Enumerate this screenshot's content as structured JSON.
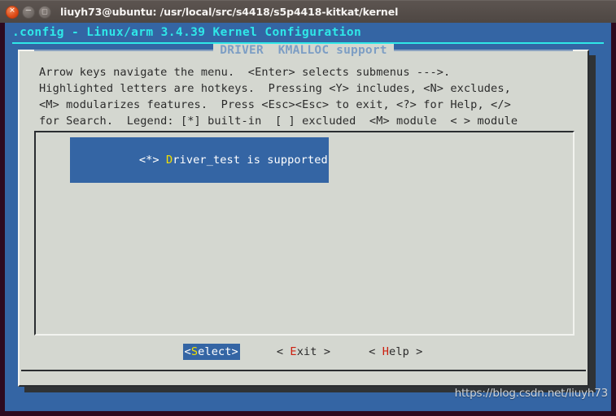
{
  "window": {
    "title": "liuyh73@ubuntu: /usr/local/src/s4418/s5p4418-kitkat/kernel",
    "controls": {
      "close_glyph": "✕",
      "minimize_glyph": "‒",
      "maximize_glyph": "□"
    }
  },
  "terminal": {
    "kconfig_title": ".config - Linux/arm 3.4.39 Kernel Configuration"
  },
  "dialog": {
    "menu_heading": "DRIVER  KMALLOC support",
    "help_text": "Arrow keys navigate the menu.  <Enter> selects submenus --->.\nHighlighted letters are hotkeys.  Pressing <Y> includes, <N> excludes,\n<M> modularizes features.  Press <Esc><Esc> to exit, <?> for Help, </>\nfor Search.  Legend: [*] built-in  [ ] excluded  <M> module  < > module",
    "items": [
      {
        "prefix": "<*> ",
        "hotkey": "D",
        "rest": "river_test is supported",
        "full_label": "<*> Driver_test is supported",
        "selected": true
      }
    ],
    "buttons": [
      {
        "open": "<",
        "pre": "",
        "hotkey": "S",
        "rest": "elect",
        "close": ">",
        "label": "<Select>",
        "active": true
      },
      {
        "open": "< ",
        "pre": "",
        "hotkey": "E",
        "rest": "xit",
        "close": " >",
        "label": "< Exit >",
        "active": false
      },
      {
        "open": "< ",
        "pre": "",
        "hotkey": "H",
        "rest": "elp",
        "close": " >",
        "label": "< Help >",
        "active": false
      }
    ]
  },
  "watermark": {
    "text": "https://blog.csdn.net/liuyh73"
  },
  "colors": {
    "terminal_bg": "#3465a4",
    "dialog_bg": "#d4d7d0",
    "accent_cyan": "#2fe8e8",
    "highlight_blue": "#3465a4",
    "hotkey_yellow": "#f4e000",
    "hotkey_red": "#cc2010",
    "heading_blue": "#7d9ec4"
  }
}
